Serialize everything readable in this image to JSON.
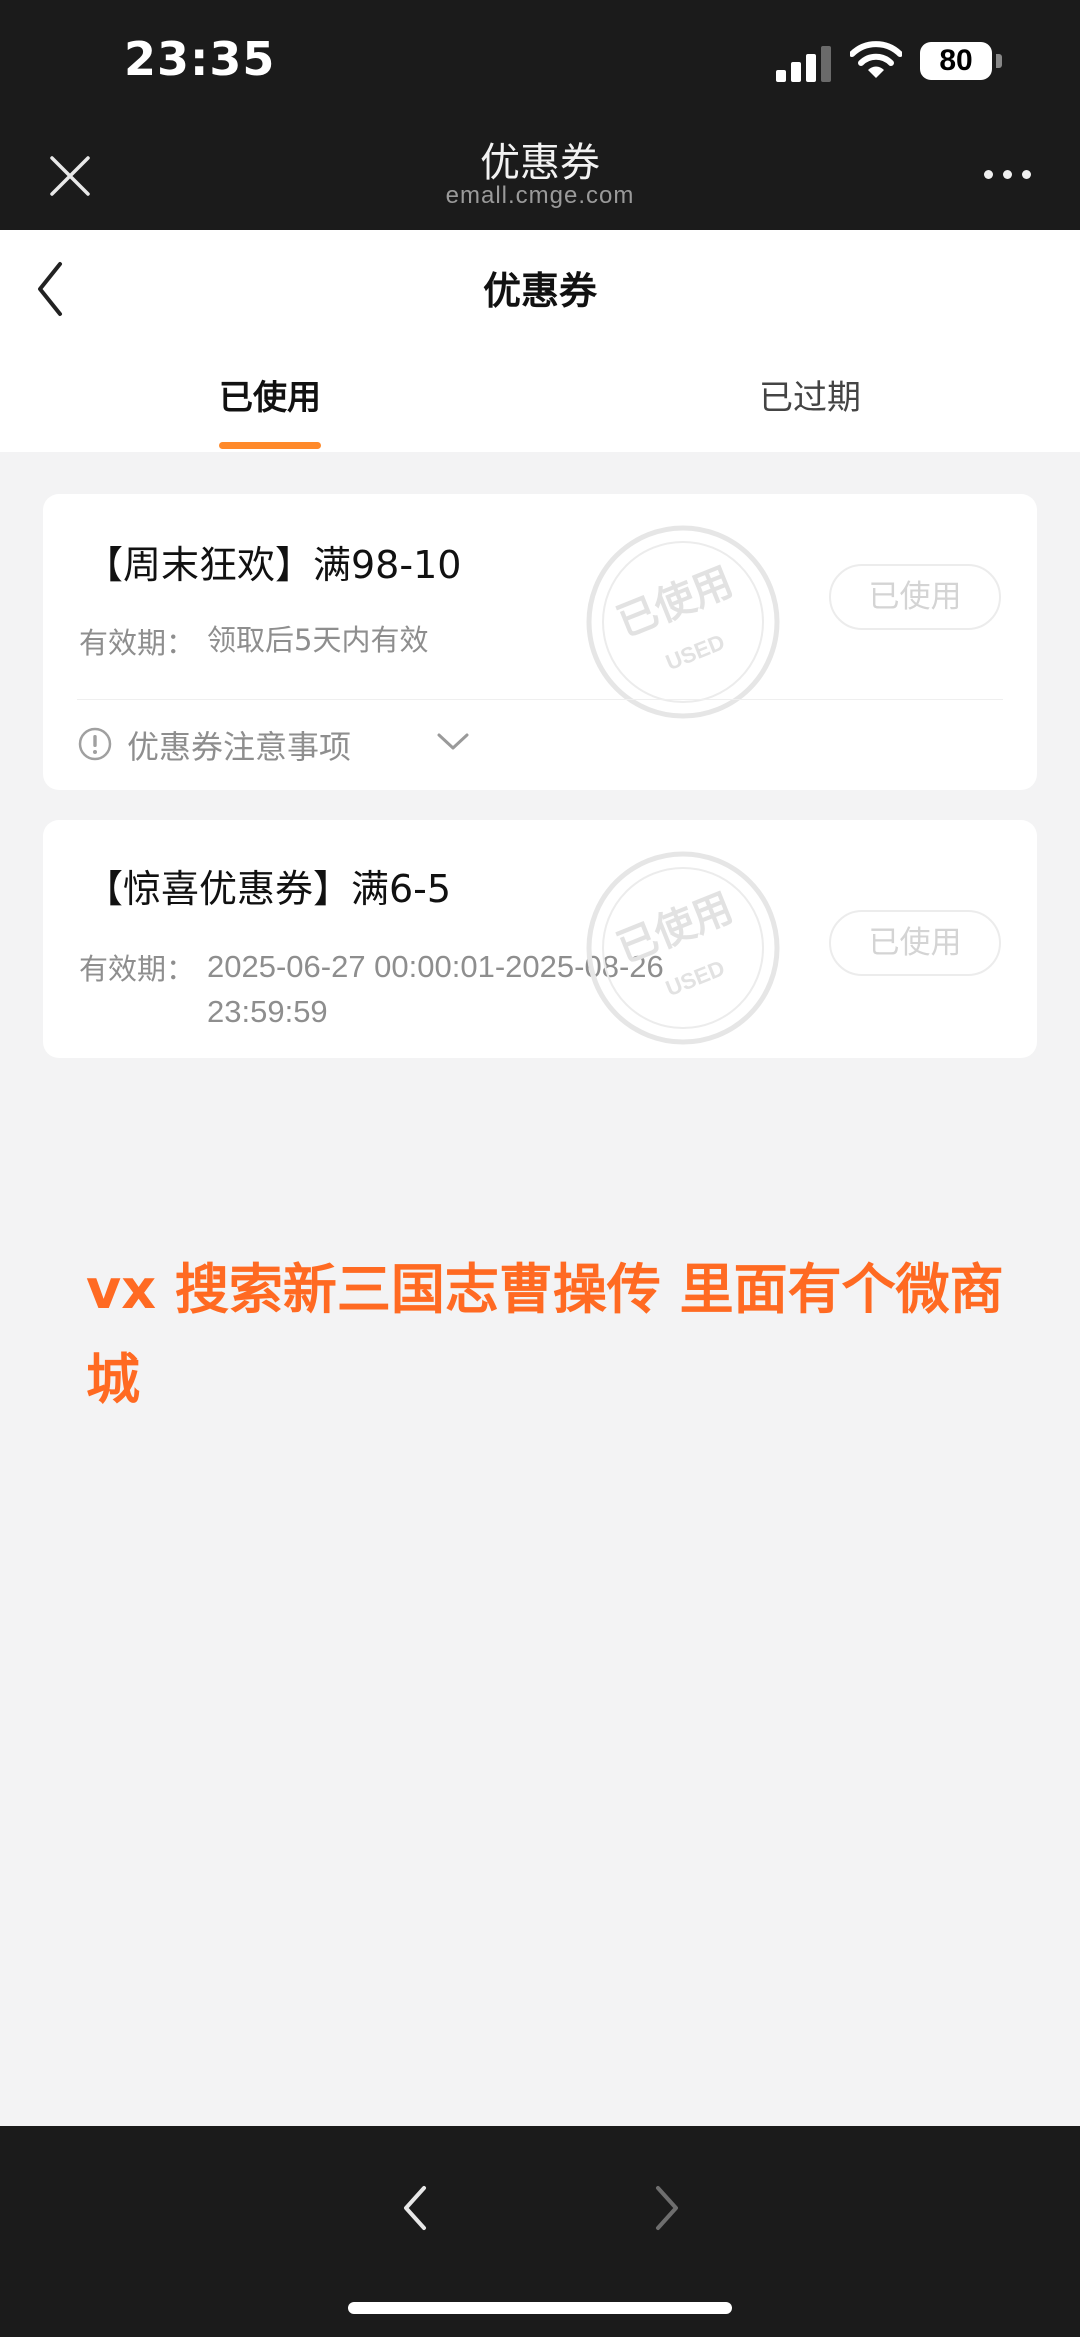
{
  "status_bar": {
    "time": "23:35",
    "battery": "80",
    "icons": [
      "signal-icon",
      "wifi-icon",
      "battery-icon"
    ]
  },
  "browser": {
    "title": "优惠券",
    "url": "emall.cmge.com",
    "icons": [
      "close-icon",
      "more-icon"
    ]
  },
  "header": {
    "title": "优惠券",
    "back_icon": "chevron-left-icon"
  },
  "tabs": [
    {
      "label": "已使用",
      "active": true
    },
    {
      "label": "已过期",
      "active": false
    }
  ],
  "accent_color": "#ff8a2b",
  "coupons": [
    {
      "name": "【周末狂欢】满98-10",
      "validity_label": "有效期：",
      "validity_value": "领取后5天内有效",
      "button_label": "已使用",
      "stamp_text": "已使用",
      "stamp_subtext": "USED",
      "notice": "优惠券注意事项"
    },
    {
      "name": "【惊喜优惠券】满6-5",
      "validity_label": "有效期：",
      "validity_value": "2025-06-27 00:00:01-2025-08-26 23:59:59",
      "button_label": "已使用",
      "stamp_text": "已使用",
      "stamp_subtext": "USED"
    }
  ],
  "caption": {
    "text": "vx 搜索新三国志曹操传 里面有个微商城",
    "color": "#ff6a22"
  },
  "bottom_nav": {
    "icons": [
      "chevron-left-icon",
      "chevron-right-icon"
    ]
  }
}
